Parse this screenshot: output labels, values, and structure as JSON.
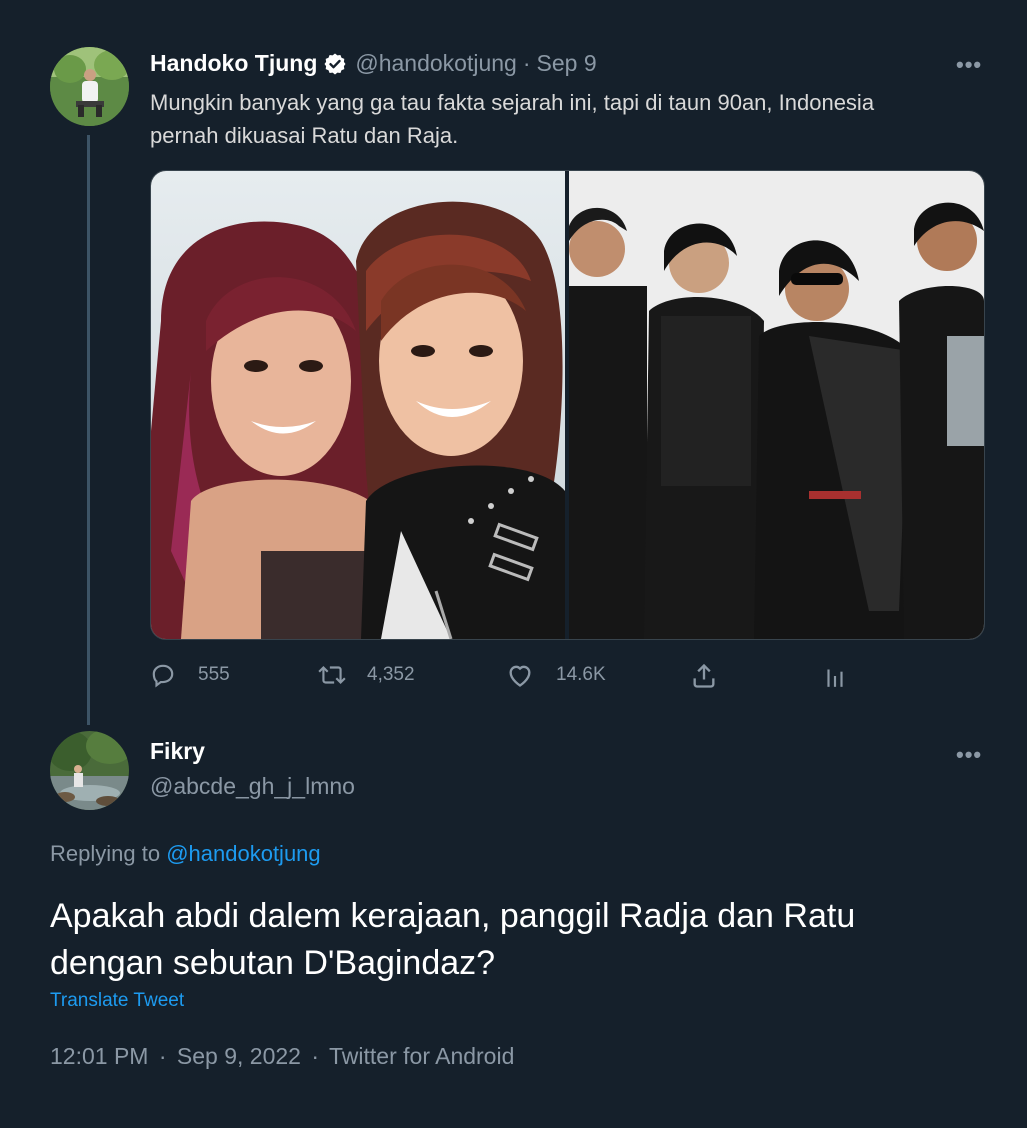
{
  "original_tweet": {
    "display_name": "Handoko Tjung",
    "handle": "@handokotjung",
    "separator": "·",
    "date": "Sep 9",
    "text_line1": "Mungkin banyak yang ga tau fakta sejarah ini, tapi di taun 90an, Indonesia",
    "text_line2": "pernah dikuasai Ratu dan Raja.",
    "more_icon": "ellipsis-icon",
    "verified_icon": "verified-badge-icon",
    "media": [
      {
        "name": "photo-left"
      },
      {
        "name": "photo-right"
      }
    ],
    "actions": {
      "replies": "555",
      "retweets": "4,352",
      "likes": "14.6K"
    }
  },
  "reply_tweet": {
    "display_name": "Fikry",
    "handle": "@abcde_gh_j_lmno",
    "replying_to_prefix": "Replying to",
    "replying_to_handle": "@handokotjung",
    "text_line1": "Apakah abdi dalem kerajaan, panggil Radja dan Ratu",
    "text_line2": "dengan sebutan D'Bagindaz?",
    "translate": "Translate Tweet",
    "time": "12:01 PM",
    "date": "Sep 9, 2022",
    "client": "Twitter for Android",
    "separator": "·"
  },
  "colors": {
    "background": "#15202b",
    "link": "#1d9bf0",
    "muted": "#8b98a5",
    "text": "#d9d9d9",
    "thread_line": "#3d5466"
  }
}
